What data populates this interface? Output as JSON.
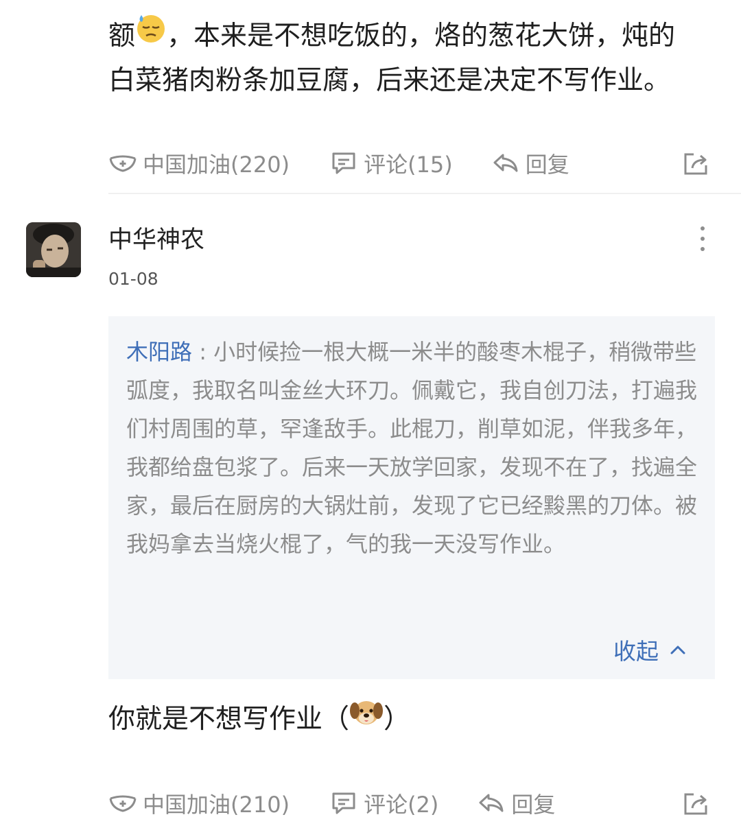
{
  "post": {
    "text_prefix": "额",
    "text_line1_rest": "，本来是不想吃饭的，烙的葱花大饼，炖的",
    "text_line2": "白菜猪肉粉条加豆腐，后来还是决定不写作业。",
    "actions": {
      "cheer": "中国加油(220)",
      "comment": "评论(15)",
      "reply": "回复"
    }
  },
  "comment": {
    "username": "中华神农",
    "date": "01-08",
    "quote": {
      "author": "木阳路",
      "separator": " : ",
      "text": "小时候捡一根大概一米半的酸枣木棍子，稍微带些弧度，我取名叫金丝大环刀。佩戴它，我自创刀法，打遍我们村周围的草，罕逢敌手。此棍刀，削草如泥，伴我多年，我都给盘包浆了。后来一天放学回家，发现不在了，找遍全家，最后在厨房的大锅灶前，发现了它已经黢黑的刀体。被我妈拿去当烧火棍了，气的我一天没写作业。",
      "collapse_label": "收起"
    },
    "text_main": "你就是不想写作业（",
    "text_end": "）",
    "actions": {
      "cheer": "中国加油(210)",
      "comment": "评论(2)",
      "reply": "回复"
    }
  },
  "colors": {
    "link": "#3f6fb8",
    "muted": "#8c8c8c",
    "quote_bg": "#f4f6f9"
  },
  "icons": [
    "sweat-emoji",
    "mask-icon",
    "comment-icon",
    "reply-icon",
    "share-icon",
    "more-icon",
    "chevron-up-icon",
    "dog-emoji",
    "avatar"
  ]
}
